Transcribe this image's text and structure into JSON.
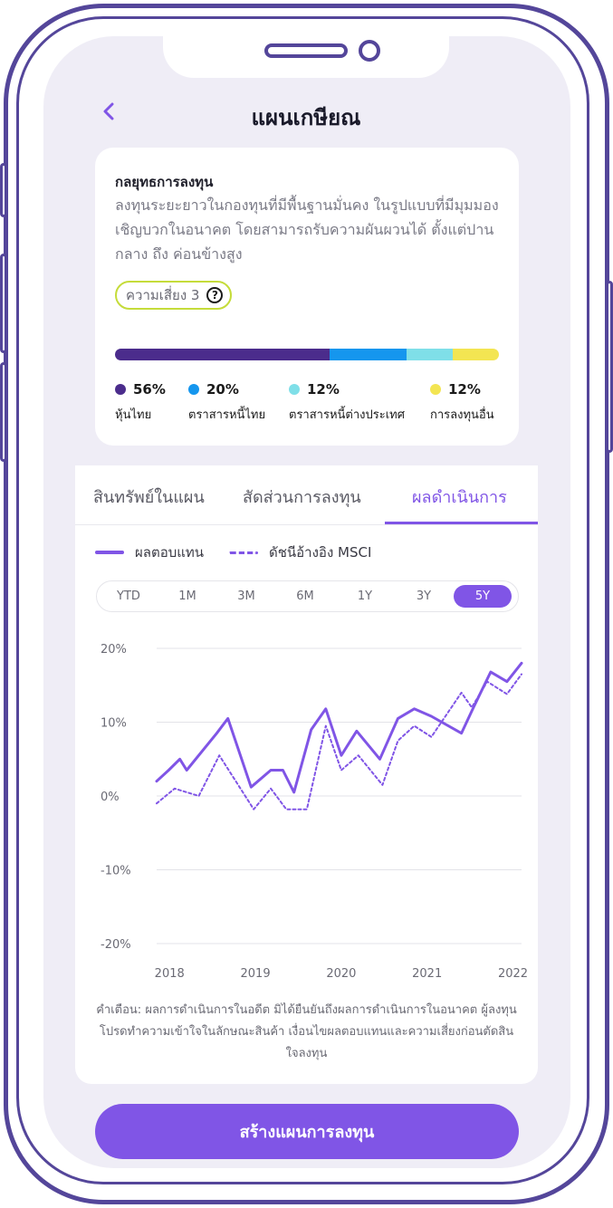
{
  "header": {
    "title": "แผนเกษียณ",
    "back_icon": "chevron-left-icon"
  },
  "strategy": {
    "title": "กลยุทธการลงทุน",
    "description": "ลงทุนระยะยาวในกองทุนที่มีพื้นฐานมั่นคง ในรูปแบบที่มีมุมมองเชิญบวกในอนาคต โดยสามารถรับความผันผวนได้ ตั้งแต่ปานกลาง ถึง ค่อนข้างสูง",
    "risk_label": "ความเสี่ยง 3",
    "help_icon": "question-circle-icon"
  },
  "allocation": [
    {
      "percent": 56,
      "label": "56%",
      "name": "หุ้นไทย",
      "color": "#4b2c8c"
    },
    {
      "percent": 20,
      "label": "20%",
      "name": "ตราสารหนี้ไทย",
      "color": "#1596ee"
    },
    {
      "percent": 12,
      "label": "12%",
      "name": "ตราสารหนี้ต่างประเทศ",
      "color": "#7fdfe8"
    },
    {
      "percent": 12,
      "label": "12%",
      "name": "การลงทุนอื่น",
      "color": "#f3e552"
    }
  ],
  "tabs": [
    "สินทรัพย์ในแผน",
    "สัดส่วนการลงทุน",
    "ผลดำเนินการ"
  ],
  "active_tab": "ผลดำเนินการ",
  "periods": [
    "YTD",
    "1M",
    "3M",
    "6M",
    "1Y",
    "3Y",
    "5Y"
  ],
  "active_period": "5Y",
  "colors": {
    "accent": "#8055e6",
    "text_dark": "#1a1a2a",
    "background": "#efedf6"
  },
  "chart_data": {
    "type": "line",
    "title": "",
    "xlabel": "",
    "ylabel": "",
    "ylim": [
      -20,
      20
    ],
    "xlim": [
      2017.85,
      2022.1
    ],
    "y_ticks": [
      20,
      10,
      0,
      -10,
      -20
    ],
    "y_tick_labels": [
      "20%",
      "10%",
      "0%",
      "-10%",
      "-20%"
    ],
    "x_ticks": [
      2018,
      2019,
      2020,
      2021,
      2022
    ],
    "x_tick_labels": [
      "2018",
      "2019",
      "2020",
      "2021",
      "2022"
    ],
    "grid": true,
    "legend_position": "top-left",
    "series": [
      {
        "name": "ผลตอบแทน",
        "style": "solid",
        "x": [
          2017.85,
          2017.99,
          2018.12,
          2018.2,
          2018.55,
          2018.68,
          2018.95,
          2019.18,
          2019.32,
          2019.45,
          2019.65,
          2019.82,
          2020.0,
          2020.18,
          2020.45,
          2020.66,
          2020.85,
          2021.05,
          2021.4,
          2021.54,
          2021.74,
          2021.93,
          2022.1
        ],
        "y": [
          2.0,
          3.5,
          5.0,
          3.5,
          8.5,
          10.5,
          1.2,
          3.5,
          3.5,
          0.5,
          9.0,
          11.8,
          5.5,
          8.8,
          5.0,
          10.5,
          11.8,
          10.8,
          8.5,
          12.0,
          16.8,
          15.5,
          18.0
        ]
      },
      {
        "name": "ดัชนีอ้างอิง MSCI",
        "style": "dashed",
        "x": [
          2017.85,
          2018.06,
          2018.34,
          2018.58,
          2018.98,
          2019.18,
          2019.36,
          2019.6,
          2019.82,
          2020.0,
          2020.2,
          2020.48,
          2020.66,
          2020.85,
          2021.05,
          2021.4,
          2021.52,
          2021.7,
          2021.93,
          2022.1
        ],
        "y": [
          -1.0,
          1.0,
          0.0,
          5.5,
          -1.8,
          1.0,
          -1.8,
          -1.8,
          9.5,
          3.5,
          5.5,
          1.5,
          7.5,
          9.5,
          8.0,
          14.0,
          12.0,
          15.5,
          13.8,
          16.5
        ]
      }
    ]
  },
  "disclaimer": "คำเตือน: ผลการดำเนินการในอดีต มิได้ยืนยันถึงผลการดำเนินการในอนาคต ผู้ลงทุนโปรดทำความเข้าใจในลักษณะสินค้า เงื่อนไขผลตอบแทนและความเสี่ยงก่อนตัดสินใจลงทุน",
  "cta_label": "สร้างแผนการลงทุน"
}
